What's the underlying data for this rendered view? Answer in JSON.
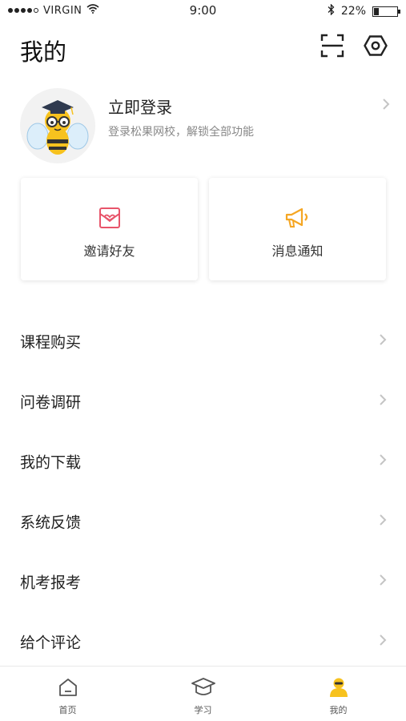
{
  "status_bar": {
    "carrier": "VIRGIN",
    "time": "9:00",
    "battery": "22%",
    "battery_level": 0.22,
    "signal_bars": 4
  },
  "header": {
    "title": "我的",
    "icons": [
      "scan-icon",
      "settings-icon"
    ]
  },
  "profile": {
    "login_title": "立即登录",
    "login_subtitle": "登录松果网校，解锁全部功能",
    "avatar": "bee-mascot-avatar"
  },
  "cards": [
    {
      "label": "邀请好友",
      "icon": "heart-letter-icon",
      "color": "#e8546a"
    },
    {
      "label": "消息通知",
      "icon": "megaphone-icon",
      "color": "#f5a623"
    }
  ],
  "menu": [
    {
      "label": "课程购买"
    },
    {
      "label": "问卷调研"
    },
    {
      "label": "我的下载"
    },
    {
      "label": "系统反馈"
    },
    {
      "label": "机考报考"
    },
    {
      "label": "给个评论"
    }
  ],
  "tabs": [
    {
      "label": "首页",
      "icon": "home-icon",
      "active": false
    },
    {
      "label": "学习",
      "icon": "graduation-cap-icon",
      "active": false
    },
    {
      "label": "我的",
      "icon": "user-icon",
      "active": true
    }
  ],
  "colors": {
    "accent": "#f7c21e",
    "text": "#222222",
    "muted": "#888888",
    "chevron": "#c4c4c4"
  }
}
